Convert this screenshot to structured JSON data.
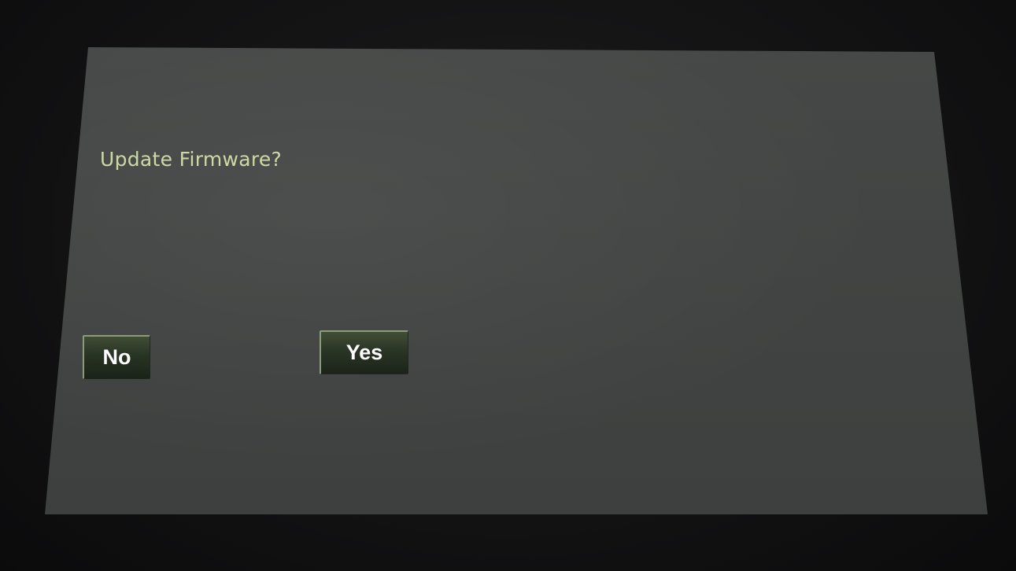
{
  "dialog": {
    "title": "Update Firmware?",
    "no_label": "No",
    "yes_label": "Yes"
  },
  "colors": {
    "title_text": "#c9d8a0",
    "screen_bg": "#444645",
    "button_bg": "#243020",
    "button_text": "#ffffff"
  }
}
